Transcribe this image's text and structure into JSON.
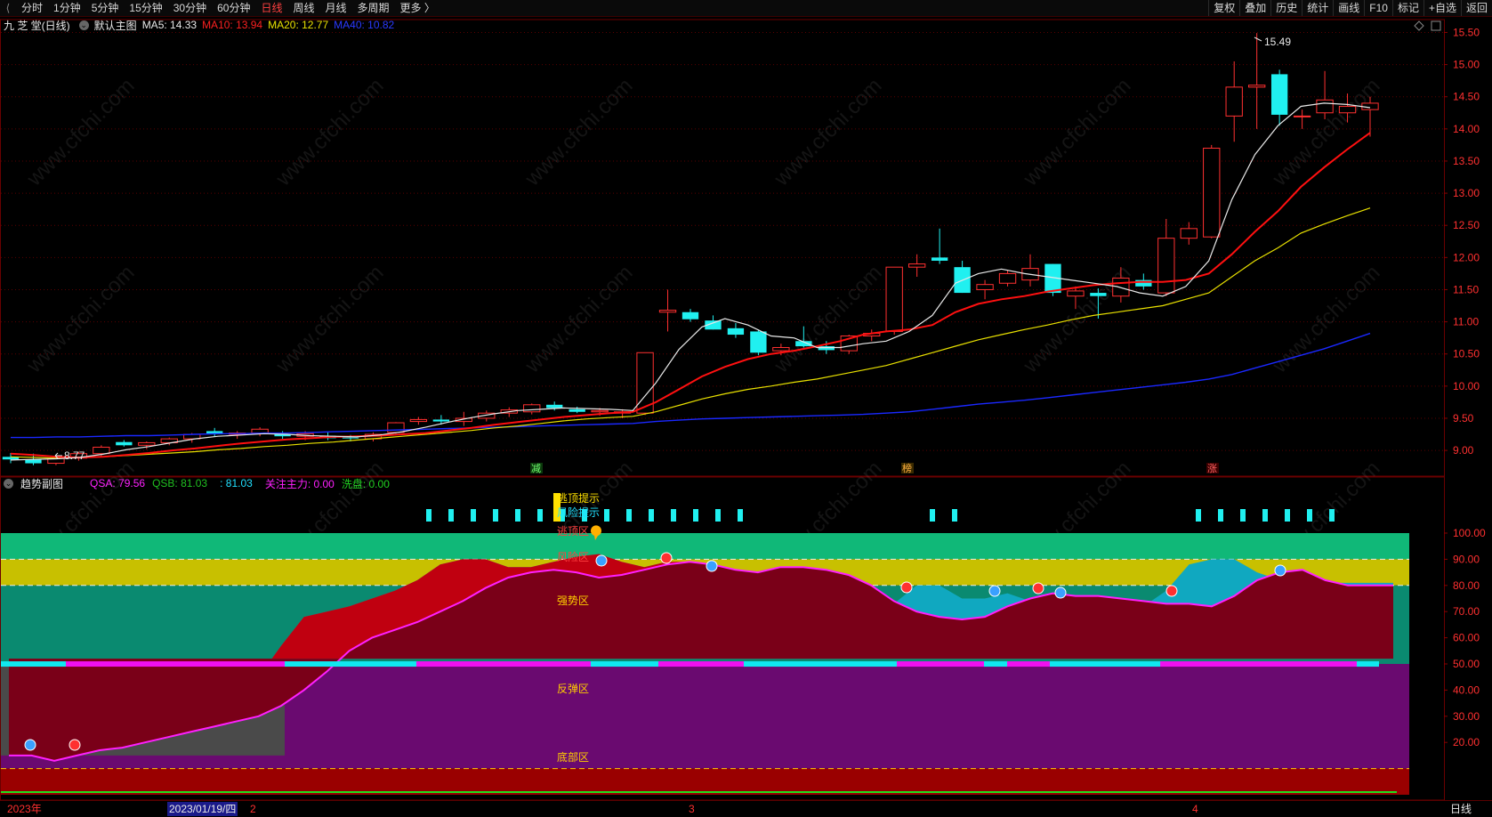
{
  "toolbar": {
    "periods": [
      "分时",
      "1分钟",
      "5分钟",
      "15分钟",
      "30分钟",
      "60分钟",
      "日线",
      "周线",
      "月线",
      "多周期",
      "更多 〉"
    ],
    "active_period": "日线",
    "tools": [
      "复权",
      "叠加",
      "历史",
      "统计",
      "画线",
      "F10",
      "标记",
      "+自选",
      "返回"
    ]
  },
  "main_legend": {
    "stock": "九 芝 堂(日线)",
    "template": "默认主图",
    "ma5": "MA5: 14.33",
    "ma10": "MA10: 13.94",
    "ma20": "MA20: 12.77",
    "ma40": "MA40: 10.82",
    "colors": {
      "ma5": "#e8e8e8",
      "ma10": "#ff2020",
      "ma20": "#e8e000",
      "ma40": "#1a28ff"
    }
  },
  "sub_legend": {
    "title": "趋势副图",
    "qsa": "QSA: 79.56",
    "qsb": "QSB: 81.03",
    "blank": ": 81.03",
    "zhuli": "关注主力: 0.00",
    "xipan": "洗盘: 0.00",
    "colors": {
      "qsa": "#ff20ff",
      "qsb": "#20c020",
      "blank": "#20e0ff",
      "zhuli": "#ff20ff",
      "xipan": "#20d020"
    }
  },
  "markers": {
    "jian": "减",
    "bang": "榜",
    "zhang": "涨"
  },
  "annotations": {
    "high": "15.49",
    "low": "8.77"
  },
  "zones": {
    "escape_hint": "逃顶提示",
    "risk_hint": "风险提示",
    "escape_zone": "逃顶区",
    "risk_zone": "风险区",
    "strong_zone": "强势区",
    "rebound_zone": "反弹区",
    "bottom_zone": "底部区"
  },
  "bottom": {
    "year": "2023年",
    "cursor_date": "2023/01/19/四",
    "m2": "2",
    "m3": "3",
    "m4": "4",
    "period": "日线"
  },
  "chart_data": [
    {
      "type": "candlestick",
      "title": "九 芝 堂(日线)",
      "y_ticks": [
        15.5,
        15.0,
        14.5,
        14.0,
        13.5,
        13.0,
        12.5,
        12.0,
        11.5,
        11.0,
        10.5,
        10.0,
        9.5,
        9.0
      ],
      "ylim": [
        8.6,
        15.7
      ],
      "candles": [
        {
          "o": 8.9,
          "h": 8.96,
          "l": 8.8,
          "c": 8.86
        },
        {
          "o": 8.86,
          "h": 8.95,
          "l": 8.77,
          "c": 8.8
        },
        {
          "o": 8.8,
          "h": 8.92,
          "l": 8.77,
          "c": 8.88
        },
        {
          "o": 8.88,
          "h": 8.98,
          "l": 8.84,
          "c": 8.95
        },
        {
          "o": 8.95,
          "h": 9.08,
          "l": 8.9,
          "c": 9.05
        },
        {
          "o": 9.13,
          "h": 9.16,
          "l": 9.06,
          "c": 9.08
        },
        {
          "o": 9.08,
          "h": 9.14,
          "l": 9.02,
          "c": 9.12
        },
        {
          "o": 9.12,
          "h": 9.2,
          "l": 9.08,
          "c": 9.18
        },
        {
          "o": 9.18,
          "h": 9.27,
          "l": 9.12,
          "c": 9.25
        },
        {
          "o": 9.3,
          "h": 9.35,
          "l": 9.22,
          "c": 9.25
        },
        {
          "o": 9.25,
          "h": 9.3,
          "l": 9.18,
          "c": 9.27
        },
        {
          "o": 9.27,
          "h": 9.36,
          "l": 9.22,
          "c": 9.33
        },
        {
          "o": 9.25,
          "h": 9.3,
          "l": 9.18,
          "c": 9.22
        },
        {
          "o": 9.22,
          "h": 9.3,
          "l": 9.16,
          "c": 9.26
        },
        {
          "o": 9.23,
          "h": 9.28,
          "l": 9.16,
          "c": 9.19
        },
        {
          "o": 9.2,
          "h": 9.24,
          "l": 9.14,
          "c": 9.19
        },
        {
          "o": 9.18,
          "h": 9.28,
          "l": 9.14,
          "c": 9.25
        },
        {
          "o": 9.28,
          "h": 9.44,
          "l": 9.26,
          "c": 9.43
        },
        {
          "o": 9.45,
          "h": 9.52,
          "l": 9.4,
          "c": 9.48
        },
        {
          "o": 9.48,
          "h": 9.55,
          "l": 9.4,
          "c": 9.45
        },
        {
          "o": 9.45,
          "h": 9.6,
          "l": 9.38,
          "c": 9.5
        },
        {
          "o": 9.5,
          "h": 9.62,
          "l": 9.45,
          "c": 9.58
        },
        {
          "o": 9.58,
          "h": 9.67,
          "l": 9.52,
          "c": 9.63
        },
        {
          "o": 9.6,
          "h": 9.73,
          "l": 9.56,
          "c": 9.71
        },
        {
          "o": 9.71,
          "h": 9.76,
          "l": 9.62,
          "c": 9.66
        },
        {
          "o": 9.64,
          "h": 9.68,
          "l": 9.58,
          "c": 9.6
        },
        {
          "o": 9.6,
          "h": 9.66,
          "l": 9.54,
          "c": 9.62
        },
        {
          "o": 9.58,
          "h": 9.64,
          "l": 9.5,
          "c": 9.6
        },
        {
          "o": 9.58,
          "h": 10.52,
          "l": 9.55,
          "c": 10.52
        },
        {
          "o": 11.15,
          "h": 11.5,
          "l": 10.85,
          "c": 11.18
        },
        {
          "o": 11.15,
          "h": 11.2,
          "l": 11.0,
          "c": 11.04
        },
        {
          "o": 11.02,
          "h": 11.1,
          "l": 10.88,
          "c": 10.88
        },
        {
          "o": 10.9,
          "h": 10.98,
          "l": 10.75,
          "c": 10.8
        },
        {
          "o": 10.85,
          "h": 10.88,
          "l": 10.48,
          "c": 10.52
        },
        {
          "o": 10.55,
          "h": 10.66,
          "l": 10.48,
          "c": 10.6
        },
        {
          "o": 10.7,
          "h": 10.93,
          "l": 10.6,
          "c": 10.62
        },
        {
          "o": 10.62,
          "h": 10.7,
          "l": 10.5,
          "c": 10.56
        },
        {
          "o": 10.55,
          "h": 10.8,
          "l": 10.5,
          "c": 10.78
        },
        {
          "o": 10.78,
          "h": 10.88,
          "l": 10.7,
          "c": 10.82
        },
        {
          "o": 10.85,
          "h": 11.85,
          "l": 10.8,
          "c": 11.85
        },
        {
          "o": 11.85,
          "h": 12.05,
          "l": 11.7,
          "c": 11.9
        },
        {
          "o": 12.0,
          "h": 12.45,
          "l": 11.9,
          "c": 11.95
        },
        {
          "o": 11.85,
          "h": 11.95,
          "l": 11.45,
          "c": 11.45
        },
        {
          "o": 11.5,
          "h": 11.65,
          "l": 11.35,
          "c": 11.58
        },
        {
          "o": 11.6,
          "h": 11.8,
          "l": 11.55,
          "c": 11.75
        },
        {
          "o": 11.65,
          "h": 12.05,
          "l": 11.55,
          "c": 11.83
        },
        {
          "o": 11.9,
          "h": 11.9,
          "l": 11.4,
          "c": 11.45
        },
        {
          "o": 11.4,
          "h": 11.55,
          "l": 11.2,
          "c": 11.48
        },
        {
          "o": 11.45,
          "h": 11.52,
          "l": 11.05,
          "c": 11.4
        },
        {
          "o": 11.4,
          "h": 11.85,
          "l": 11.3,
          "c": 11.68
        },
        {
          "o": 11.65,
          "h": 11.75,
          "l": 11.5,
          "c": 11.55
        },
        {
          "o": 11.45,
          "h": 12.6,
          "l": 11.4,
          "c": 12.3
        },
        {
          "o": 12.3,
          "h": 12.55,
          "l": 12.2,
          "c": 12.45
        },
        {
          "o": 12.32,
          "h": 13.75,
          "l": 12.3,
          "c": 13.7
        },
        {
          "o": 14.2,
          "h": 15.05,
          "l": 13.8,
          "c": 14.65
        },
        {
          "o": 14.65,
          "h": 15.49,
          "l": 14.0,
          "c": 14.68
        },
        {
          "o": 14.85,
          "h": 14.92,
          "l": 14.05,
          "c": 14.22
        },
        {
          "o": 14.2,
          "h": 14.3,
          "l": 14.0,
          "c": 14.2
        },
        {
          "o": 14.25,
          "h": 14.9,
          "l": 14.15,
          "c": 14.45
        },
        {
          "o": 14.25,
          "h": 14.55,
          "l": 14.1,
          "c": 14.35
        },
        {
          "o": 14.3,
          "h": 14.5,
          "l": 13.88,
          "c": 14.4
        }
      ],
      "ma5": [
        8.85,
        8.86,
        8.87,
        8.89,
        8.94,
        9.01,
        9.06,
        9.12,
        9.18,
        9.22,
        9.24,
        9.26,
        9.25,
        9.23,
        9.22,
        9.21,
        9.24,
        9.29,
        9.36,
        9.44,
        9.51,
        9.57,
        9.62,
        9.64,
        9.66,
        9.65,
        9.64,
        9.62,
        10.05,
        10.57,
        10.92,
        11.05,
        10.95,
        10.78,
        10.75,
        10.6,
        10.6,
        10.66,
        10.7,
        10.85,
        11.1,
        11.6,
        11.75,
        11.82,
        11.75,
        11.7,
        11.65,
        11.6,
        11.55,
        11.45,
        11.4,
        11.55,
        11.95,
        12.9,
        13.6,
        14.05,
        14.35,
        14.4,
        14.38,
        14.33
      ],
      "ma10": [
        8.95,
        8.93,
        8.9,
        8.89,
        8.9,
        8.93,
        8.96,
        9.0,
        9.03,
        9.07,
        9.11,
        9.14,
        9.17,
        9.19,
        9.21,
        9.22,
        9.23,
        9.25,
        9.27,
        9.31,
        9.35,
        9.4,
        9.44,
        9.48,
        9.52,
        9.55,
        9.58,
        9.6,
        9.75,
        9.95,
        10.15,
        10.3,
        10.42,
        10.5,
        10.55,
        10.62,
        10.7,
        10.8,
        10.85,
        10.88,
        10.95,
        11.15,
        11.28,
        11.35,
        11.4,
        11.47,
        11.52,
        11.57,
        11.6,
        11.62,
        11.62,
        11.65,
        11.75,
        12.05,
        12.4,
        12.72,
        13.1,
        13.4,
        13.68,
        13.94
      ],
      "ma20": [
        8.9,
        8.89,
        8.88,
        8.89,
        8.9,
        8.92,
        8.94,
        8.96,
        8.98,
        9.01,
        9.03,
        9.06,
        9.08,
        9.11,
        9.13,
        9.16,
        9.19,
        9.22,
        9.25,
        9.28,
        9.31,
        9.35,
        9.38,
        9.42,
        9.46,
        9.49,
        9.51,
        9.53,
        9.6,
        9.7,
        9.8,
        9.88,
        9.95,
        10.0,
        10.06,
        10.11,
        10.18,
        10.25,
        10.32,
        10.42,
        10.52,
        10.62,
        10.72,
        10.8,
        10.88,
        10.95,
        11.03,
        11.1,
        11.15,
        11.2,
        11.25,
        11.35,
        11.45,
        11.7,
        11.95,
        12.15,
        12.38,
        12.52,
        12.65,
        12.77
      ],
      "ma40": [
        9.2,
        9.2,
        9.21,
        9.21,
        9.22,
        9.23,
        9.23,
        9.24,
        9.25,
        9.26,
        9.26,
        9.27,
        9.27,
        9.28,
        9.29,
        9.3,
        9.31,
        9.32,
        9.33,
        9.34,
        9.35,
        9.36,
        9.37,
        9.38,
        9.39,
        9.4,
        9.41,
        9.42,
        9.45,
        9.47,
        9.49,
        9.5,
        9.51,
        9.52,
        9.53,
        9.54,
        9.55,
        9.56,
        9.58,
        9.6,
        9.64,
        9.68,
        9.72,
        9.75,
        9.78,
        9.82,
        9.86,
        9.9,
        9.94,
        9.98,
        10.02,
        10.06,
        10.11,
        10.18,
        10.28,
        10.38,
        10.48,
        10.58,
        10.7,
        10.82
      ]
    },
    {
      "type": "area",
      "title": "趋势副图",
      "y_ticks": [
        100.0,
        90.0,
        80.0,
        70.0,
        60.0,
        50.0,
        40.0,
        30.0,
        20.0
      ],
      "ylim": [
        0,
        110
      ],
      "series": [
        {
          "name": "QSA",
          "values": [
            15,
            15,
            13,
            15,
            17,
            18,
            20,
            22,
            24,
            26,
            28,
            30,
            34,
            40,
            47,
            55,
            60,
            63,
            66,
            70,
            74,
            79,
            83,
            85,
            86,
            85,
            83,
            84,
            86,
            88,
            89,
            88,
            86,
            85,
            87,
            87,
            86,
            84,
            80,
            74,
            70,
            68,
            67,
            68,
            72,
            75,
            77,
            76,
            76,
            75,
            74,
            73,
            73,
            72,
            76,
            82,
            85,
            86,
            82,
            80,
            80,
            80
          ]
        },
        {
          "name": "QSB",
          "values": [
            16,
            16,
            16,
            18,
            20,
            22,
            24,
            26,
            29,
            32,
            36,
            45,
            57,
            68,
            70,
            72,
            75,
            78,
            82,
            88,
            90,
            90,
            87,
            87,
            89,
            91,
            92,
            89,
            87,
            89,
            88,
            86,
            83,
            78,
            72,
            68,
            65,
            64,
            65,
            73,
            80,
            80,
            75,
            75,
            77,
            74,
            73,
            72,
            72,
            71,
            72,
            78,
            88,
            90,
            90,
            85,
            82,
            82,
            81,
            81,
            81,
            81
          ]
        }
      ],
      "hint_bars_count": [
        15,
        3,
        7
      ],
      "zone_bands": [
        [
          90,
          100
        ],
        [
          80,
          90
        ],
        [
          50,
          80
        ],
        [
          10,
          50
        ],
        [
          0,
          10
        ]
      ]
    }
  ]
}
